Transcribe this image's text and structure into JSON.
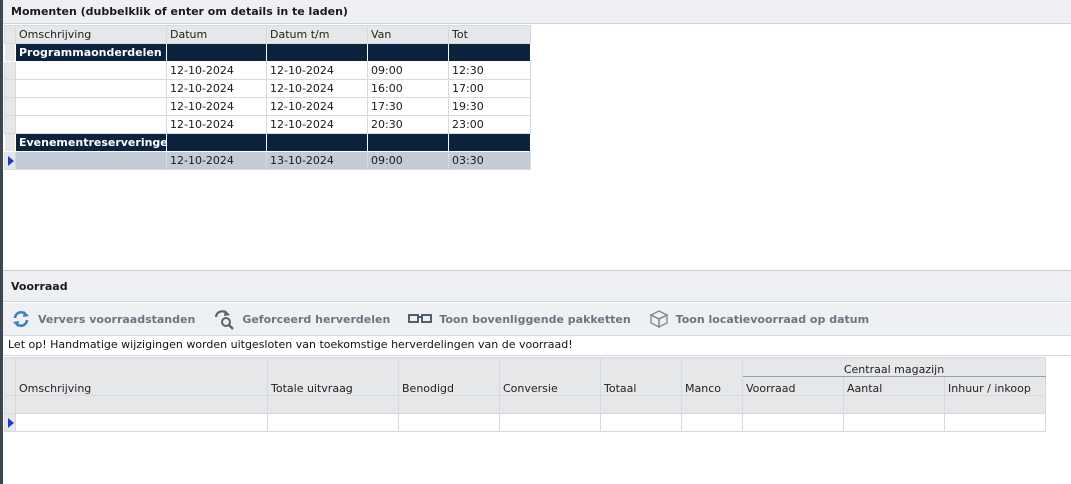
{
  "momenten": {
    "title": "Momenten (dubbelklik of enter om details in te laden)",
    "columns": [
      "Omschrijving",
      "Datum",
      "Datum t/m",
      "Van",
      "Tot"
    ],
    "groups": [
      {
        "name": "Programmaonderdelen",
        "rows": [
          {
            "omschrijving": "",
            "datum": "12-10-2024",
            "datum_tm": "12-10-2024",
            "van": "09:00",
            "tot": "12:30"
          },
          {
            "omschrijving": "",
            "datum": "12-10-2024",
            "datum_tm": "12-10-2024",
            "van": "16:00",
            "tot": "17:00"
          },
          {
            "omschrijving": "",
            "datum": "12-10-2024",
            "datum_tm": "12-10-2024",
            "van": "17:30",
            "tot": "19:30"
          },
          {
            "omschrijving": "",
            "datum": "12-10-2024",
            "datum_tm": "12-10-2024",
            "van": "20:30",
            "tot": "23:00"
          }
        ]
      },
      {
        "name": "Evenementreserveringen",
        "rows": [
          {
            "omschrijving": "",
            "datum": "12-10-2024",
            "datum_tm": "13-10-2024",
            "van": "09:00",
            "tot": "03:30"
          }
        ]
      }
    ]
  },
  "voorraad": {
    "title": "Voorraad",
    "toolbar": {
      "refresh": "Ververs voorraadstanden",
      "force": "Geforceerd herverdelen",
      "packages": "Toon bovenliggende pakketten",
      "location": "Toon locatievoorraad op datum"
    },
    "warning": "Let op! Handmatige wijzigingen worden uitgesloten van toekomstige herverdelingen van de voorraad!",
    "columns": {
      "omschrijving": "Omschrijving",
      "totale_uitvraag": "Totale uitvraag",
      "benodigd": "Benodigd",
      "conversie": "Conversie",
      "totaal": "Totaal",
      "manco": "Manco",
      "group": "Centraal magazijn",
      "voorraad": "Voorraad",
      "aantal": "Aantal",
      "inhuur": "Inhuur / inkoop"
    }
  },
  "colors": {
    "group_row": "#0c2340",
    "current_row": "#c3ccd6",
    "header_bg": "#eef0f4",
    "toolbar_text": "#6a7583"
  }
}
